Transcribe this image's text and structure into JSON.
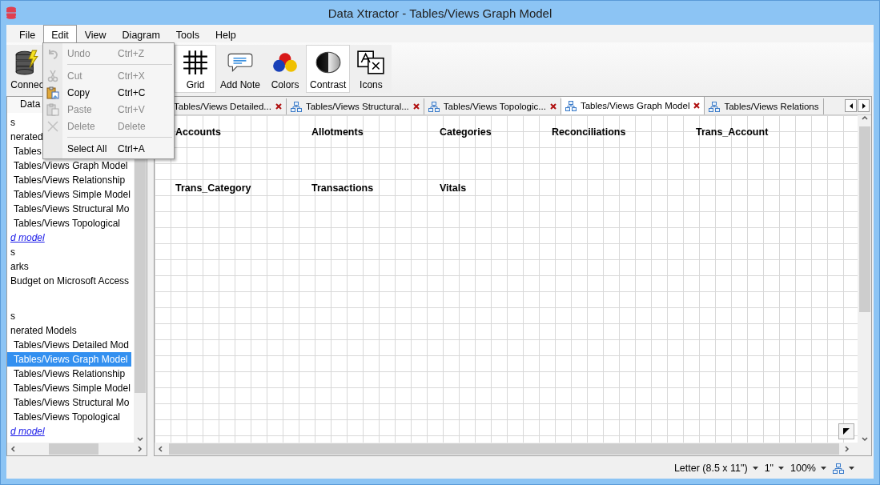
{
  "window": {
    "title": "Data Xtractor - Tables/Views Graph Model"
  },
  "menu": [
    {
      "label": "File",
      "selected": false
    },
    {
      "label": "Edit",
      "selected": true
    },
    {
      "label": "View",
      "selected": false
    },
    {
      "label": "Diagram",
      "selected": false
    },
    {
      "label": "Tools",
      "selected": false
    },
    {
      "label": "Help",
      "selected": false
    }
  ],
  "edit_menu": [
    {
      "kind": "undo",
      "label": "Undo",
      "shortcut": "Ctrl+Z",
      "disabled": true
    },
    {
      "kind": "separator"
    },
    {
      "kind": "cut",
      "label": "Cut",
      "shortcut": "Ctrl+X",
      "disabled": true
    },
    {
      "kind": "copy",
      "label": "Copy",
      "shortcut": "Ctrl+C",
      "disabled": false
    },
    {
      "kind": "paste",
      "label": "Paste",
      "shortcut": "Ctrl+V",
      "disabled": true
    },
    {
      "kind": "delete",
      "label": "Delete",
      "shortcut": "Delete",
      "disabled": true
    },
    {
      "kind": "separator"
    },
    {
      "kind": "select_all",
      "label": "Select All",
      "shortcut": "Ctrl+A",
      "disabled": false
    }
  ],
  "toolbar": [
    {
      "kind": "connect",
      "label": "Connec",
      "selected": false
    },
    {
      "kind": "grid",
      "label": "Grid",
      "selected": true
    },
    {
      "kind": "note",
      "label": "Add Note",
      "selected": false
    },
    {
      "kind": "colors",
      "label": "Colors",
      "selected": false
    },
    {
      "kind": "contrast",
      "label": "Contrast",
      "selected": true
    },
    {
      "kind": "icons",
      "label": "Icons",
      "selected": false
    }
  ],
  "sidebar": {
    "header": "Data",
    "tree": [
      {
        "label": "s"
      },
      {
        "label": "nerated",
        "children": [
          {
            "label": "Tables,",
            "selected": false
          },
          {
            "label": "Tables/Views Graph Model",
            "selected": false
          },
          {
            "label": "Tables/Views Relationship",
            "selected": false
          },
          {
            "label": "Tables/Views Simple Model",
            "selected": false
          },
          {
            "label": "Tables/Views Structural Mo",
            "selected": false
          },
          {
            "label": "Tables/Views Topological",
            "selected": false
          }
        ]
      },
      {
        "label": "d model",
        "kind": "link"
      },
      {
        "label": "s"
      },
      {
        "label": "arks"
      },
      {
        "label": "Budget on Microsoft Access"
      },
      {
        "label": "s",
        "gap": true
      },
      {
        "label": "nerated Models",
        "children": [
          {
            "label": "Tables/Views Detailed Mod",
            "selected": false
          },
          {
            "label": "Tables/Views Graph Model",
            "selected": true
          },
          {
            "label": "Tables/Views Relationship",
            "selected": false
          },
          {
            "label": "Tables/Views Simple Model",
            "selected": false
          },
          {
            "label": "Tables/Views Structural Mo",
            "selected": false
          },
          {
            "label": "Tables/Views Topological",
            "selected": false
          }
        ]
      },
      {
        "label": "d model",
        "kind": "link"
      }
    ]
  },
  "tabs": [
    {
      "label": "Tables/Views Detailed...",
      "selected": false,
      "icon": false,
      "closable": true
    },
    {
      "label": "Tables/Views Structural...",
      "selected": false,
      "icon": true,
      "closable": true
    },
    {
      "label": "Tables/Views Topologic...",
      "selected": false,
      "icon": true,
      "closable": true
    },
    {
      "label": "Tables/Views Graph Model",
      "selected": true,
      "icon": true,
      "closable": true
    },
    {
      "label": "Tables/Views Relations",
      "selected": false,
      "icon": true,
      "closable": false
    }
  ],
  "diagram": {
    "tables": [
      [
        "Accounts",
        "Allotments",
        "Categories",
        "Reconciliations",
        "Trans_Account"
      ],
      [
        "Trans_Category",
        "Transactions",
        "Vitals"
      ]
    ]
  },
  "status_bar": {
    "paper": "Letter (8.5 x 11\")",
    "margin": "1\"",
    "zoom": "100%"
  }
}
